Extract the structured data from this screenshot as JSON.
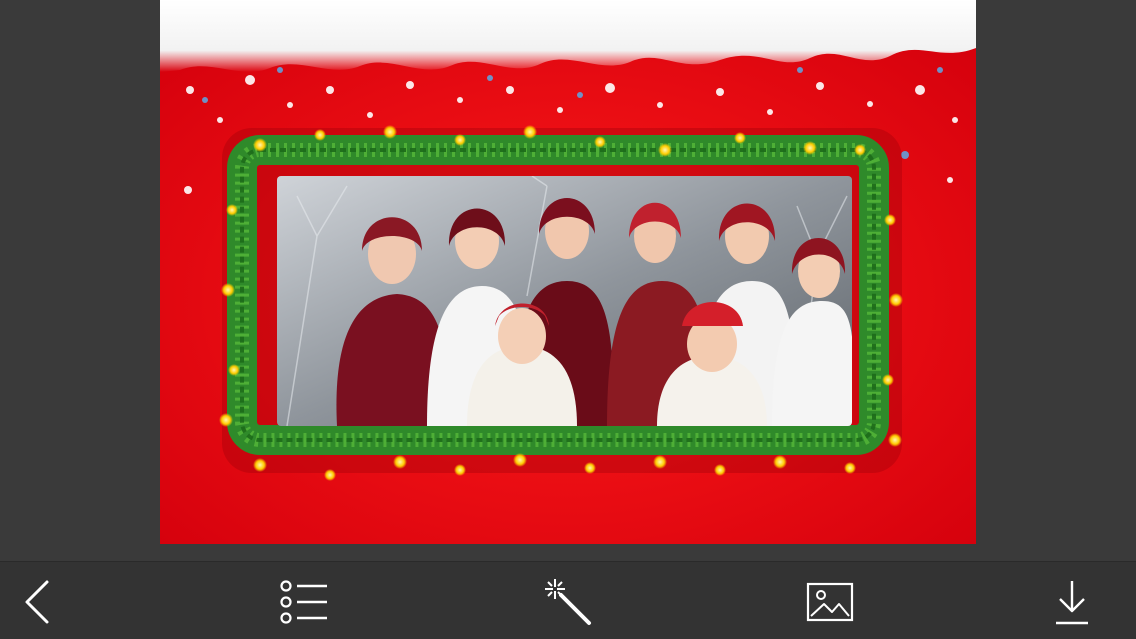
{
  "editor": {
    "frame_theme": "christmas-garland-red",
    "colors": {
      "background": "#3a3a3a",
      "toolbar": "#333333",
      "frame_red": "#e3000f",
      "garland_green": "#2f8a2a",
      "icon": "#ffffff"
    }
  },
  "toolbar": {
    "items": [
      {
        "icon": "chevron-left-icon",
        "action": "back"
      },
      {
        "icon": "list-icon",
        "action": "frames-list"
      },
      {
        "icon": "magic-wand-icon",
        "action": "effects"
      },
      {
        "icon": "image-icon",
        "action": "gallery"
      },
      {
        "icon": "download-icon",
        "action": "save"
      }
    ]
  }
}
